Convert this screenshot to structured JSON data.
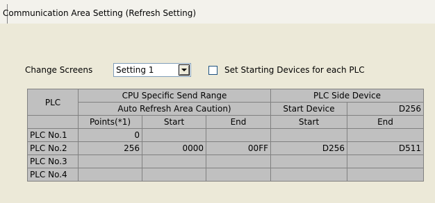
{
  "tab": {
    "label": "Communication Area Setting (Refresh Setting)"
  },
  "change_screens": {
    "label": "Change Screens",
    "selected": "Setting 1"
  },
  "checkbox": {
    "label": "Set Starting Devices for each PLC",
    "checked": false
  },
  "table": {
    "h_plc": "PLC",
    "h_cpu": "CPU Specific Send Range",
    "h_plc_side": "PLC Side Device",
    "h_auto": "Auto Refresh Area  Caution)",
    "h_start_device": "Start Device",
    "start_device_value": "D256",
    "h_points": "Points(*1)",
    "h_start": "Start",
    "h_end": "End",
    "h_start2": "Start",
    "h_end2": "End",
    "rows": [
      {
        "plc": "PLC No.1",
        "points": "0",
        "start": "",
        "end": "",
        "dstart": "",
        "dend": ""
      },
      {
        "plc": "PLC No.2",
        "points": "256",
        "start": "0000",
        "end": "00FF",
        "dstart": "D256",
        "dend": "D511"
      },
      {
        "plc": "PLC No.3",
        "points": "",
        "start": "",
        "end": "",
        "dstart": "",
        "dend": ""
      },
      {
        "plc": "PLC No.4",
        "points": "",
        "start": "",
        "end": "",
        "dstart": "",
        "dend": ""
      }
    ]
  }
}
